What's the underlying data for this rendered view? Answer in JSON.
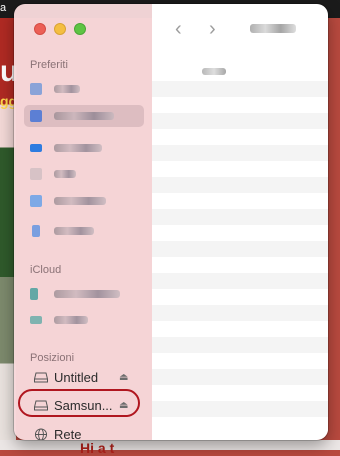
{
  "desktop": {
    "menubar_text": "a",
    "bg_text_1": "u",
    "bg_text_2": "gg",
    "bg_bottom_text": "Hi a t"
  },
  "window": {
    "sections": {
      "favorites": "Preferiti",
      "icloud": "iCloud",
      "locations": "Posizioni"
    },
    "favorites": [
      {
        "icon": "blurred-app-icon",
        "color": "#8aa3d8"
      },
      {
        "icon": "blurred-folder-icon",
        "color": "#5c7fd4",
        "selected": true
      },
      {
        "icon": "blurred-desktop-icon",
        "color": "#2e7ce0"
      },
      {
        "icon": "blurred-icon",
        "color": "#d7c2c6"
      },
      {
        "icon": "blurred-document-icon",
        "color": "#7ea9e6"
      },
      {
        "icon": "blurred-download-icon",
        "color": "#7a9fe0"
      }
    ],
    "icloud": [
      {
        "icon": "blurred-cloud-icon",
        "color": "#63a8a6"
      },
      {
        "icon": "blurred-folder-icon",
        "color": "#7fb3b0"
      }
    ],
    "locations": [
      {
        "label": "Untitled",
        "icon": "external-drive-icon",
        "eject": "⏏"
      },
      {
        "label": "Samsun...",
        "icon": "external-drive-icon",
        "eject": "⏏"
      },
      {
        "label": "Rete",
        "icon": "network-globe-icon"
      }
    ],
    "toolbar": {
      "back": "‹",
      "forward": "›"
    }
  }
}
